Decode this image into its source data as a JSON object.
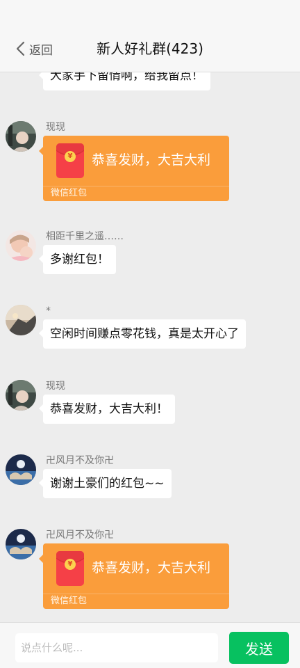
{
  "header": {
    "back_label": "返回",
    "title": "新人好礼群(423)"
  },
  "messages": [
    {
      "type": "text",
      "text": "大家手下留情啊，给我留点！"
    },
    {
      "type": "redpacket",
      "nickname": "现现",
      "text": "恭喜发财，大吉大利",
      "footer": "微信红包"
    },
    {
      "type": "text",
      "nickname": "相距千里之遥……",
      "text": "多谢红包！"
    },
    {
      "type": "text",
      "nickname": "*",
      "text": "空闲时间赚点零花钱，真是太开心了"
    },
    {
      "type": "text",
      "nickname": "现现",
      "text": "恭喜发财，大吉大利！"
    },
    {
      "type": "text",
      "nickname": "卍风月不及你卍",
      "text": "谢谢土豪们的红包~~"
    },
    {
      "type": "redpacket",
      "nickname": "卍风月不及你卍",
      "text": "恭喜发财，大吉大利",
      "footer": "微信红包"
    }
  ],
  "input": {
    "placeholder": "说点什么呢...",
    "send_label": "发送"
  },
  "colors": {
    "accent_green": "#07c160",
    "redpacket_orange": "#fa9d3b",
    "chat_background": "#ededed"
  },
  "icons": [
    "chevron-left-icon",
    "red-envelope-icon",
    "avatar"
  ]
}
